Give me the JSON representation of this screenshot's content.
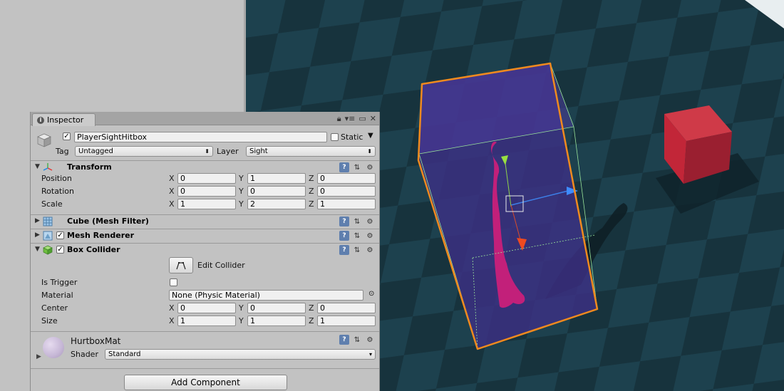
{
  "inspector": {
    "tab_label": "Inspector",
    "tab_icon": "info-icon",
    "object": {
      "name": "PlayerSightHitbox",
      "active": true,
      "static_label": "Static",
      "static": false,
      "tag_label": "Tag",
      "tag_value": "Untagged",
      "layer_label": "Layer",
      "layer_value": "Sight"
    },
    "transform": {
      "title": "Transform",
      "rows": [
        {
          "label": "Position",
          "x": "0",
          "y": "1",
          "z": "0"
        },
        {
          "label": "Rotation",
          "x": "0",
          "y": "0",
          "z": "0"
        },
        {
          "label": "Scale",
          "x": "1",
          "y": "2",
          "z": "1"
        }
      ]
    },
    "axis_labels": {
      "x": "X",
      "y": "Y",
      "z": "Z"
    },
    "mesh_filter": {
      "title": "Cube (Mesh Filter)"
    },
    "mesh_renderer": {
      "title": "Mesh Renderer",
      "enabled": true
    },
    "box_collider": {
      "title": "Box Collider",
      "enabled": true,
      "edit_collider_label": "Edit Collider",
      "is_trigger_label": "Is Trigger",
      "is_trigger": false,
      "material_label": "Material",
      "material_value": "None (Physic Material)",
      "center_label": "Center",
      "center": {
        "x": "0",
        "y": "0",
        "z": "0"
      },
      "size_label": "Size",
      "size": {
        "x": "1",
        "y": "1",
        "z": "1"
      }
    },
    "material": {
      "name": "HurtboxMat",
      "shader_label": "Shader",
      "shader_value": "Standard",
      "swatch_color": "#c6b7d6"
    },
    "add_component_label": "Add Component"
  },
  "colors": {
    "selection_outline": "#f08a1e",
    "collider_box": "#3b2f7a",
    "character": "#c2207a",
    "red_cube": "#c8283a",
    "floor_dark": "#17333d",
    "floor_light": "#1f4450"
  }
}
